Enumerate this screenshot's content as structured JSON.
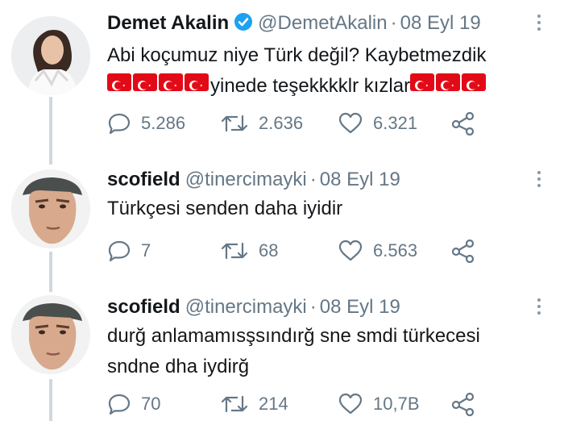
{
  "tweets": [
    {
      "name": "Demet Akalin",
      "verified": true,
      "handle": "@DemetAkalin",
      "separator": "·",
      "date": "08 Eyl 19",
      "text_line1": "Abi koçumuz niye Türk değil? Kaybetmezdik",
      "text_line2": "yinede teşekkkklr kızlar",
      "replies": "5.286",
      "retweets": "2.636",
      "likes": "6.321"
    },
    {
      "name": "scofield",
      "verified": false,
      "handle": "@tinercimayki",
      "separator": "·",
      "date": "08 Eyl 19",
      "text_line1": "Türkçesi senden daha iyidir",
      "replies": "7",
      "retweets": "68",
      "likes": "6.563"
    },
    {
      "name": "scofield",
      "verified": false,
      "handle": "@tinercimayki",
      "separator": "·",
      "date": "08 Eyl 19",
      "text_line1": "durğ anlamamısşsındırğ sne smdi türkecesi",
      "text_line2": "sndne dha iydirğ",
      "replies": "70",
      "retweets": "214",
      "likes": "10,7B"
    }
  ],
  "colors": {
    "text": "#14171a",
    "secondary": "#657786",
    "verified": "#1da1f2",
    "flag": "#e30a17",
    "thread_line": "#cfd9de"
  },
  "icons": [
    "verified-badge-icon",
    "more-icon",
    "reply-icon",
    "retweet-icon",
    "like-icon",
    "share-icon",
    "turkish-flag-icon"
  ]
}
